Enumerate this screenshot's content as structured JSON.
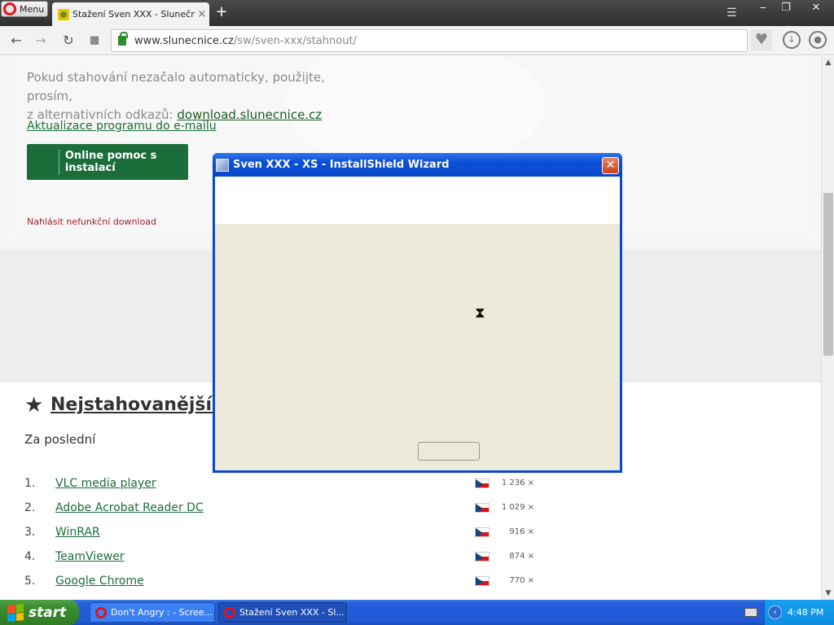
{
  "browser": {
    "menu_label": "Menu",
    "tab_title": "Stažení Sven XXX - Slunečnice",
    "tab_close": "×",
    "new_tab": "+",
    "url_host": "www.slunecnice.cz",
    "url_path": "/sw/sven-xxx/stahnout/"
  },
  "page": {
    "intro_text": "Pokud stahování nezačalo automaticky, použijte, prosím,",
    "intro_text2": "z alternativních odkazů:",
    "alt_link": "download.slunecnice.cz",
    "update_link": "Aktualizace programu do e-mailu",
    "help_button": "Online pomoc s instalací",
    "report_link": "Nahlásit nefunkční download",
    "section_title": "Nejstahovanější programy",
    "section_sub": "Za poslední",
    "rows": [
      {
        "num": "1.",
        "name": "VLC media player",
        "count": "1 236 ×"
      },
      {
        "num": "2.",
        "name": "Adobe Acrobat Reader DC",
        "count": "1 029 ×"
      },
      {
        "num": "3.",
        "name": "WinRAR",
        "count": "916 ×"
      },
      {
        "num": "4.",
        "name": "TeamViewer",
        "count": "874 ×"
      },
      {
        "num": "5.",
        "name": "Google Chrome",
        "count": "770 ×"
      }
    ]
  },
  "dialog": {
    "title": "Sven XXX - XS - InstallShield Wizard",
    "close": "✕"
  },
  "taskbar": {
    "start_label": "start",
    "tasks": [
      "Don't Angry : - Scree...",
      "Stažení Sven XXX - Sl..."
    ],
    "clock": "4:48 PM"
  }
}
